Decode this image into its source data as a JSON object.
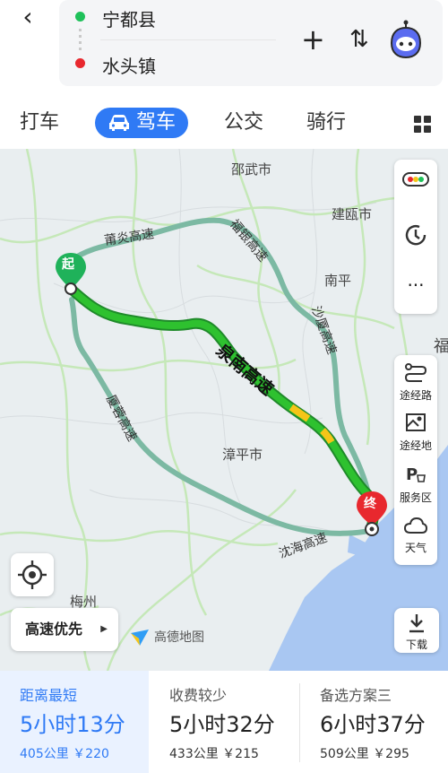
{
  "header": {
    "origin": "宁都县",
    "destination": "水头镇",
    "colors": {
      "origin_dot": "#1fc15a",
      "dest_dot": "#e8282e"
    }
  },
  "tabs": [
    {
      "label": "打车"
    },
    {
      "label": "驾车"
    },
    {
      "label": "公交"
    },
    {
      "label": "骑行"
    }
  ],
  "map": {
    "cities": [
      "邵武市",
      "建瓯市",
      "南平",
      "漳平市",
      "梅州",
      "福"
    ],
    "roads": [
      "莆炎高速",
      "福银高速",
      "沙厦高速",
      "厦蓉高速",
      "沈海高速",
      "泉南高速"
    ],
    "start_marker": "起",
    "end_marker": "终",
    "brand": "高德地图"
  },
  "side_tools": {
    "route_tool": "途经路",
    "waypoint": "途经地",
    "service": "服务区",
    "weather": "天气"
  },
  "preference": "高速优先",
  "download": "下载",
  "routes": [
    {
      "tag": "距离最短",
      "time": "5小时13分",
      "meta": "405公里 ￥220"
    },
    {
      "tag": "收费较少",
      "time": "5小时32分",
      "meta": "433公里 ￥215"
    },
    {
      "tag": "备选方案三",
      "time": "6小时37分",
      "meta": "509公里 ￥295"
    }
  ],
  "accent_color": "#2f7af5"
}
